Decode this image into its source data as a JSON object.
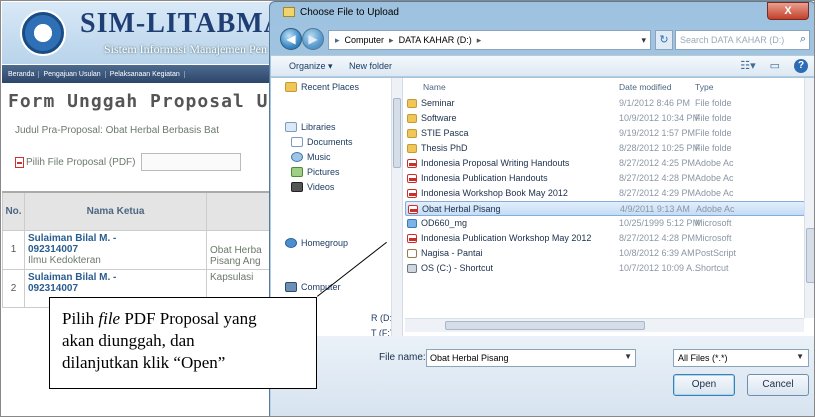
{
  "app": {
    "title": "SIM-LITABMAS",
    "subtitle": "Sistem Informasi Manajemen Pen",
    "nav": [
      "Beranda",
      "Pengajuan Usulan",
      "Pelaksanaan Kegiatan"
    ]
  },
  "form": {
    "title": "Form Unggah Proposal Us",
    "judul": "Judul Pra-Proposal: Obat Herbal Berbasis Bat",
    "pilih_label": "Pilih File Proposal (PDF)"
  },
  "table": {
    "headers": [
      "No.",
      "Nama Ketua",
      ""
    ],
    "rows": [
      {
        "no": "1",
        "name": "Sulaiman Bilal M. -",
        "nim": "092314007",
        "dept": "Ilmu Kedokteran",
        "judul": "Obat Herba\nPisang Ang"
      },
      {
        "no": "2",
        "name": "Sulaiman Bilal M. -",
        "nim": "092314007",
        "dept": "",
        "judul": "Kapsulasi"
      }
    ]
  },
  "callout": {
    "line1_pre": "Pilih ",
    "line1_em": "file",
    "line1_post": " PDF Proposal yang",
    "line2": "akan diunggah, dan",
    "line3": "dilanjutkan klik “Open”"
  },
  "dialog": {
    "title": "Choose File to Upload",
    "close": "X",
    "address": [
      "Computer",
      "DATA KAHAR (D:)"
    ],
    "search_placeholder": "Search DATA KAHAR (D:)",
    "toolbar": {
      "organize": "Organize ▾",
      "new_folder": "New folder"
    },
    "nav_items": [
      {
        "label": "Recent Places",
        "icon": "folder"
      },
      {
        "label": "Libraries",
        "icon": "lib"
      },
      {
        "label": "Documents",
        "icon": "doc"
      },
      {
        "label": "Music",
        "icon": "music"
      },
      {
        "label": "Pictures",
        "icon": "pic"
      },
      {
        "label": "Videos",
        "icon": "vid"
      },
      {
        "label": "Homegroup",
        "icon": "home"
      },
      {
        "label": "Computer",
        "icon": "comp"
      }
    ],
    "nav_extra": [
      "R (D:",
      "T (F:) ▾"
    ],
    "columns": {
      "name": "Name",
      "date": "Date modified",
      "type": "Type"
    },
    "files": [
      {
        "name": "Seminar",
        "date": "9/1/2012 8:46 PM",
        "type": "File folde",
        "icon": "folder",
        "selected": false
      },
      {
        "name": "Software",
        "date": "10/9/2012 10:34 PM",
        "type": "File folde",
        "icon": "folder",
        "selected": false
      },
      {
        "name": "STIE Pasca",
        "date": "9/19/2012 1:57 PM",
        "type": "File folde",
        "icon": "folder",
        "selected": false
      },
      {
        "name": "Thesis PhD",
        "date": "8/28/2012 10:25 PM",
        "type": "File folde",
        "icon": "folder",
        "selected": false
      },
      {
        "name": "Indonesia Proposal Writing Handouts",
        "date": "8/27/2012 4:25 PM",
        "type": "Adobe Ac",
        "icon": "pdf",
        "selected": false
      },
      {
        "name": "Indonesia Publication Handouts",
        "date": "8/27/2012 4:28 PM",
        "type": "Adobe Ac",
        "icon": "pdf",
        "selected": false
      },
      {
        "name": "Indonesia Workshop Book May 2012",
        "date": "8/27/2012 4:29 PM",
        "type": "Adobe Ac",
        "icon": "pdf",
        "selected": false
      },
      {
        "name": "Obat Herbal Pisang",
        "date": "4/9/2011 9:13 AM",
        "type": "Adobe Ac",
        "icon": "pdf",
        "selected": true
      },
      {
        "name": "OD660_mg",
        "date": "10/25/1999 5:12 PM",
        "type": "Microsoft",
        "icon": "img",
        "selected": false
      },
      {
        "name": "Indonesia Publication Workshop May 2012",
        "date": "8/27/2012 4:28 PM",
        "type": "Microsoft",
        "icon": "pdf",
        "selected": false
      },
      {
        "name": "Nagisa - Pantai",
        "date": "10/8/2012 6:39 AM",
        "type": "PostScript",
        "icon": "ps",
        "selected": false
      },
      {
        "name": "OS (C:) - Shortcut",
        "date": "10/7/2012 10:09 A...",
        "type": "Shortcut",
        "icon": "short",
        "selected": false
      }
    ],
    "file_name_label": "File name:",
    "file_name_value": "Obat Herbal Pisang",
    "file_type": "All Files (*.*)",
    "open_label": "Open",
    "cancel_label": "Cancel"
  }
}
